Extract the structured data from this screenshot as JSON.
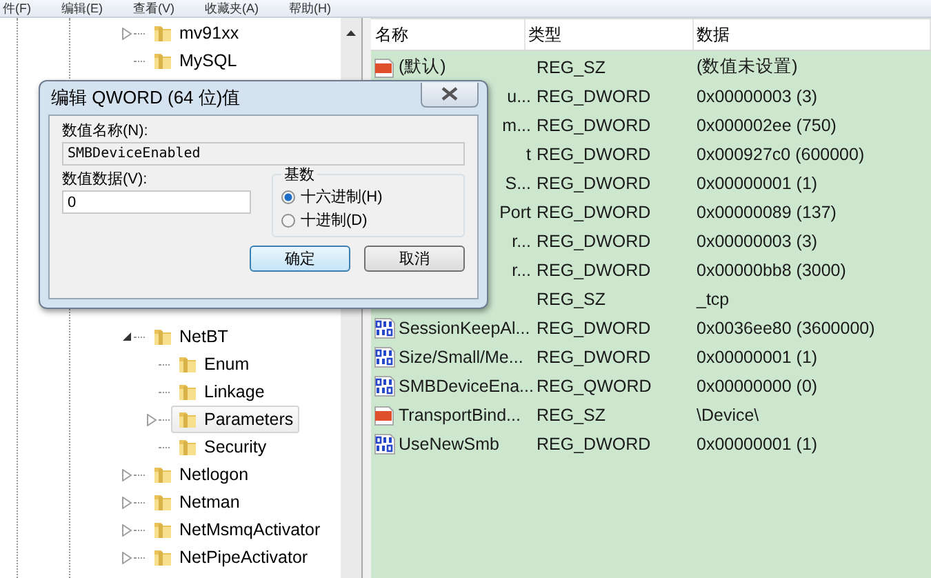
{
  "menu": [
    "件(F)",
    "编辑(E)",
    "查看(V)",
    "收藏夹(A)",
    "帮助(H)"
  ],
  "tree": [
    {
      "label": "mv91xx",
      "expanded": false,
      "selected": false
    },
    {
      "label": "MySQL",
      "selected": false
    },
    {
      "label": "NetBT",
      "expanded": true,
      "selected": false,
      "children": [
        {
          "label": "Enum",
          "selected": false
        },
        {
          "label": "Linkage",
          "selected": false
        },
        {
          "label": "Parameters",
          "expanded": false,
          "selected": true
        },
        {
          "label": "Security",
          "selected": false
        }
      ]
    },
    {
      "label": "Netlogon",
      "expanded": false,
      "selected": false
    },
    {
      "label": "Netman",
      "expanded": false,
      "selected": false
    },
    {
      "label": "NetMsmqActivator",
      "expanded": false,
      "selected": false
    },
    {
      "label": "NetPipeActivator",
      "expanded": false,
      "selected": false
    }
  ],
  "values": {
    "columns": [
      "名称",
      "类型",
      "数据"
    ],
    "rows": [
      {
        "kind": "string",
        "name": "(默认)",
        "type": "REG_SZ",
        "data": "(数值未设置)"
      },
      {
        "name": "u...",
        "type": "REG_DWORD",
        "data": "0x00000003 (3)"
      },
      {
        "name": "m...",
        "type": "REG_DWORD",
        "data": "0x000002ee (750)"
      },
      {
        "name": "t",
        "type": "REG_DWORD",
        "data": "0x000927c0 (600000)"
      },
      {
        "name": "S...",
        "type": "REG_DWORD",
        "data": "0x00000001 (1)"
      },
      {
        "name": "Port",
        "type": "REG_DWORD",
        "data": "0x00000089 (137)"
      },
      {
        "name": "r...",
        "type": "REG_DWORD",
        "data": "0x00000003 (3)"
      },
      {
        "name": "r...",
        "type": "REG_DWORD",
        "data": "0x00000bb8 (3000)"
      },
      {
        "type": "REG_SZ",
        "data": "_tcp"
      },
      {
        "kind": "number",
        "name": "SessionKeepAl...",
        "type": "REG_DWORD",
        "data": "0x0036ee80 (3600000)"
      },
      {
        "kind": "number",
        "name": "Size/Small/Me...",
        "type": "REG_DWORD",
        "data": "0x00000001 (1)"
      },
      {
        "kind": "number",
        "name": "SMBDeviceEna...",
        "type": "REG_QWORD",
        "data": "0x00000000 (0)"
      },
      {
        "kind": "string",
        "name": "TransportBind...",
        "type": "REG_SZ",
        "data": "\\Device\\"
      },
      {
        "kind": "number",
        "name": "UseNewSmb",
        "type": "REG_DWORD",
        "data": "0x00000001 (1)"
      }
    ]
  },
  "dialog": {
    "title": "编辑 QWORD (64 位)值",
    "name_label": "数值名称(N):",
    "name_value": "SMBDeviceEnabled",
    "data_label": "数值数据(V):",
    "data_value": "0",
    "base": {
      "label": "基数",
      "options": [
        {
          "label": "十六进制(H)",
          "selected": true
        },
        {
          "label": "十进制(D)",
          "selected": false
        }
      ]
    },
    "buttons": [
      {
        "label": "确定",
        "default": true
      },
      {
        "label": "取消",
        "default": false
      }
    ]
  }
}
